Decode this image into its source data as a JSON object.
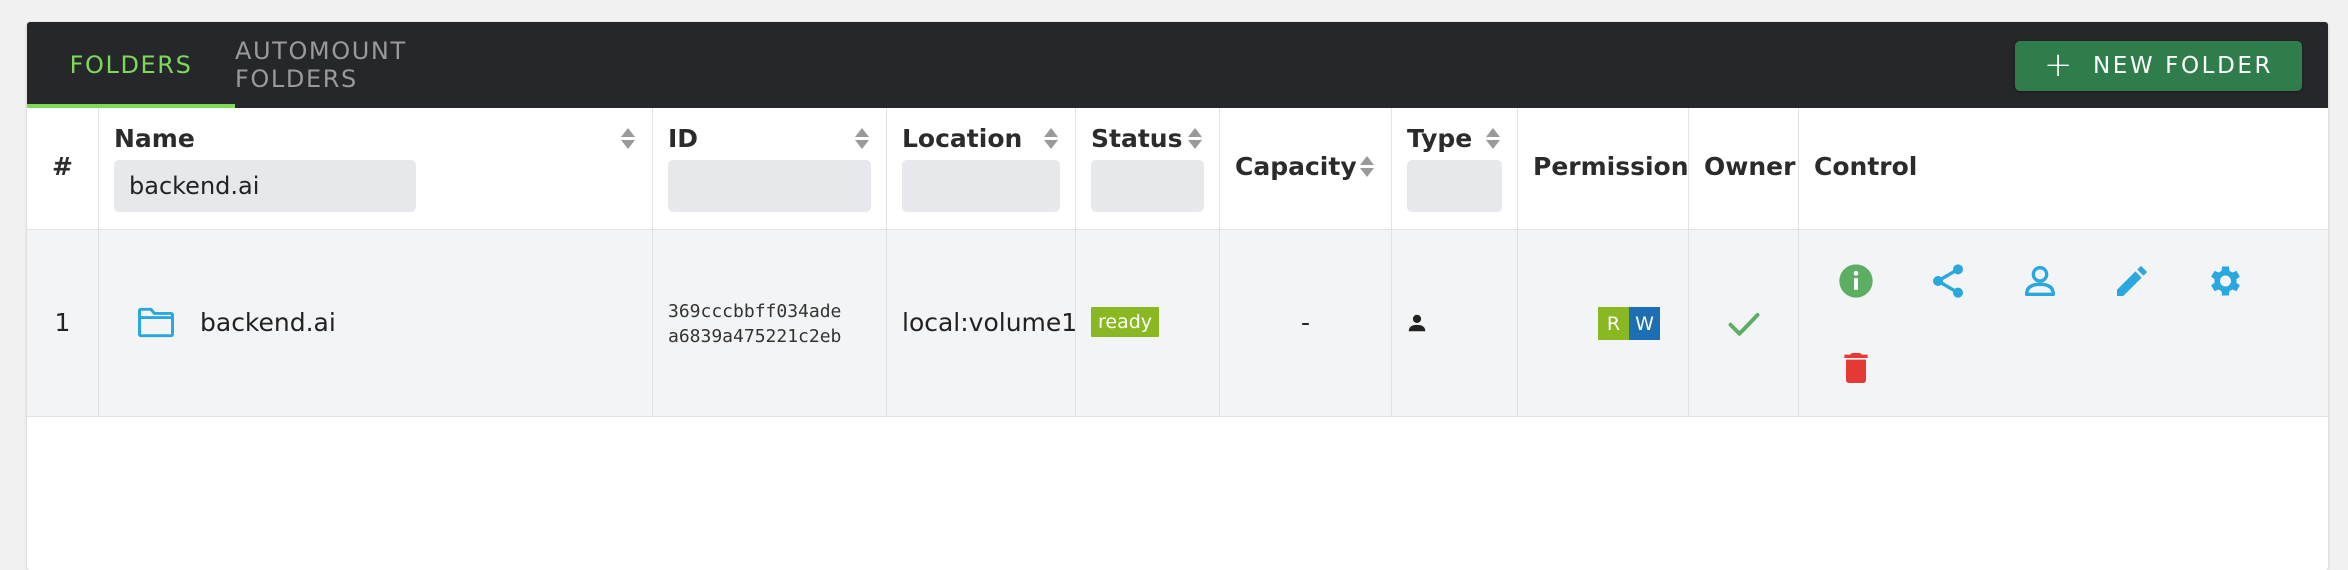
{
  "tabs": {
    "folders": "FOLDERS",
    "automount": "AUTOMOUNT FOLDERS"
  },
  "new_folder_button": {
    "icon": "+",
    "label": "NEW FOLDER"
  },
  "table": {
    "headers": {
      "index": "#",
      "name": "Name",
      "id": "ID",
      "location": "Location",
      "status": "Status",
      "capacity": "Capacity",
      "type": "Type",
      "permission": "Permission",
      "owner": "Owner",
      "control": "Control"
    },
    "filters": {
      "name": "backend.ai",
      "id": "",
      "location": "",
      "status": "",
      "type": ""
    },
    "rows": [
      {
        "index": "1",
        "name": "backend.ai",
        "id_line1": "369cccbbff034ade",
        "id_line2": "a6839a475221c2eb",
        "location": "local:volume1",
        "status": "ready",
        "capacity": "-",
        "type_icon": "person-icon",
        "permission_read": "R",
        "permission_write": "W",
        "owner_icon": "check-icon"
      }
    ]
  },
  "colors": {
    "accent_green": "#7ed957",
    "button_green": "#2e7d4a",
    "status_ready": "#8ab822",
    "perm_read": "#8ab822",
    "perm_write": "#1c6fb2",
    "icon_blue": "#29a8e0",
    "info_green": "#5cae62",
    "delete_red": "#e53935"
  }
}
